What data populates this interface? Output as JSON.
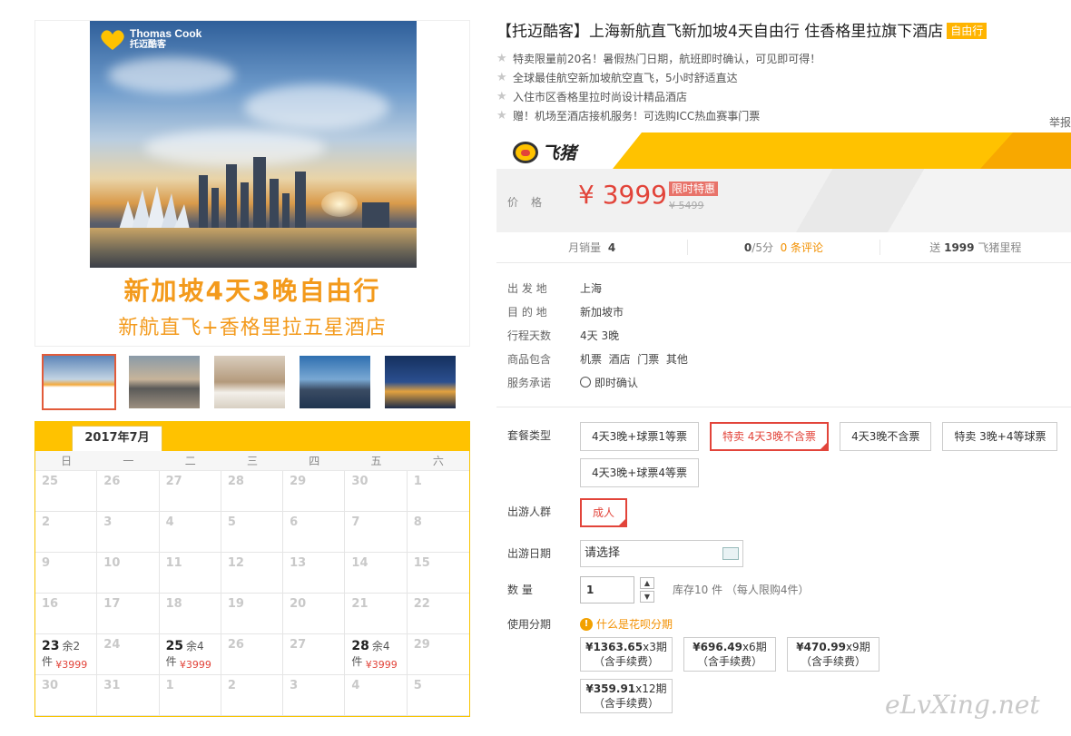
{
  "hero": {
    "brand_en": "Thomas Cook",
    "brand_cn": "托迈酷客",
    "line1": "新加坡4天3晚自由行",
    "line2": "新航直飞+香格里拉五星酒店"
  },
  "calendar": {
    "month": "2017年7月",
    "weekdays": [
      "日",
      "一",
      "二",
      "三",
      "四",
      "五",
      "六"
    ],
    "cells": [
      {
        "d": "25"
      },
      {
        "d": "26"
      },
      {
        "d": "27"
      },
      {
        "d": "28"
      },
      {
        "d": "29"
      },
      {
        "d": "30"
      },
      {
        "d": "1"
      },
      {
        "d": "2"
      },
      {
        "d": "3"
      },
      {
        "d": "4"
      },
      {
        "d": "5"
      },
      {
        "d": "6"
      },
      {
        "d": "7"
      },
      {
        "d": "8"
      },
      {
        "d": "9"
      },
      {
        "d": "10"
      },
      {
        "d": "11"
      },
      {
        "d": "12"
      },
      {
        "d": "13"
      },
      {
        "d": "14"
      },
      {
        "d": "15"
      },
      {
        "d": "16"
      },
      {
        "d": "17"
      },
      {
        "d": "18"
      },
      {
        "d": "19"
      },
      {
        "d": "20"
      },
      {
        "d": "21"
      },
      {
        "d": "22"
      },
      {
        "d": "23",
        "rem": "余2件",
        "price": "¥3999"
      },
      {
        "d": "24"
      },
      {
        "d": "25",
        "rem": "余4件",
        "price": "¥3999"
      },
      {
        "d": "26"
      },
      {
        "d": "27"
      },
      {
        "d": "28",
        "rem": "余4件",
        "price": "¥3999"
      },
      {
        "d": "29"
      },
      {
        "d": "30"
      },
      {
        "d": "31"
      },
      {
        "d": "1"
      },
      {
        "d": "2"
      },
      {
        "d": "3"
      },
      {
        "d": "4"
      },
      {
        "d": "5"
      }
    ]
  },
  "product": {
    "title": "【托迈酷客】上海新航直飞新加坡4天自由行 住香格里拉旗下酒店",
    "tag": "自由行",
    "features": [
      "特卖限量前20名！暑假热门日期，航班即时确认，可见即可得！",
      "全球最佳航空新加坡航空直飞，5小时舒适直达",
      "入住市区香格里拉时尚设计精品酒店",
      "赠！机场至酒店接机服务！可选购ICC热血赛事门票"
    ],
    "report": "举报"
  },
  "price": {
    "brand": "飞猪",
    "label": "价格",
    "value": "¥ 3999",
    "badge": "限时特惠",
    "original": "¥ 5499"
  },
  "stats": {
    "sales_label": "月销量",
    "sales": "4",
    "score": "0",
    "score_suffix": "/5分",
    "reviews": "0 条评论",
    "miles_prefix": "送",
    "miles": "1999",
    "miles_suffix": "飞猪里程"
  },
  "info": [
    {
      "k": "出 发 地",
      "v": "上海"
    },
    {
      "k": "目 的 地",
      "v": "新加坡市"
    },
    {
      "k": "行程天数",
      "v": "4天 3晚"
    },
    {
      "k": "商品包含",
      "v": "机票  酒店  门票  其他"
    },
    {
      "k": "服务承诺",
      "v": "即时确认"
    }
  ],
  "options": {
    "package_label": "套餐类型",
    "packages": [
      "4天3晚+球票1等票",
      "特卖 4天3晚不含票",
      "4天3晚不含票",
      "特卖 3晚+4等球票",
      "4天3晚+球票4等票"
    ],
    "package_selected": 1,
    "crowd_label": "出游人群",
    "crowd": "成人",
    "date_label": "出游日期",
    "date_value": "请选择",
    "qty_label": "数    量",
    "qty_value": "1",
    "stock": "库存10 件 （每人限购4件）",
    "install_label": "使用分期",
    "huabei": "什么是花呗分期",
    "installments": [
      {
        "amount": "¥1363.65",
        "period": "x3期",
        "note": "（含手续费）"
      },
      {
        "amount": "¥696.49",
        "period": "x6期",
        "note": "（含手续费）"
      },
      {
        "amount": "¥470.99",
        "period": "x9期",
        "note": "（含手续费）"
      },
      {
        "amount": "¥359.91",
        "period": "x12期",
        "note": "（含手续费）"
      }
    ]
  },
  "watermark": "eLvXing.net",
  "colors": {
    "accent": "#ffc200",
    "price": "#e2443a",
    "link": "#f29000"
  }
}
